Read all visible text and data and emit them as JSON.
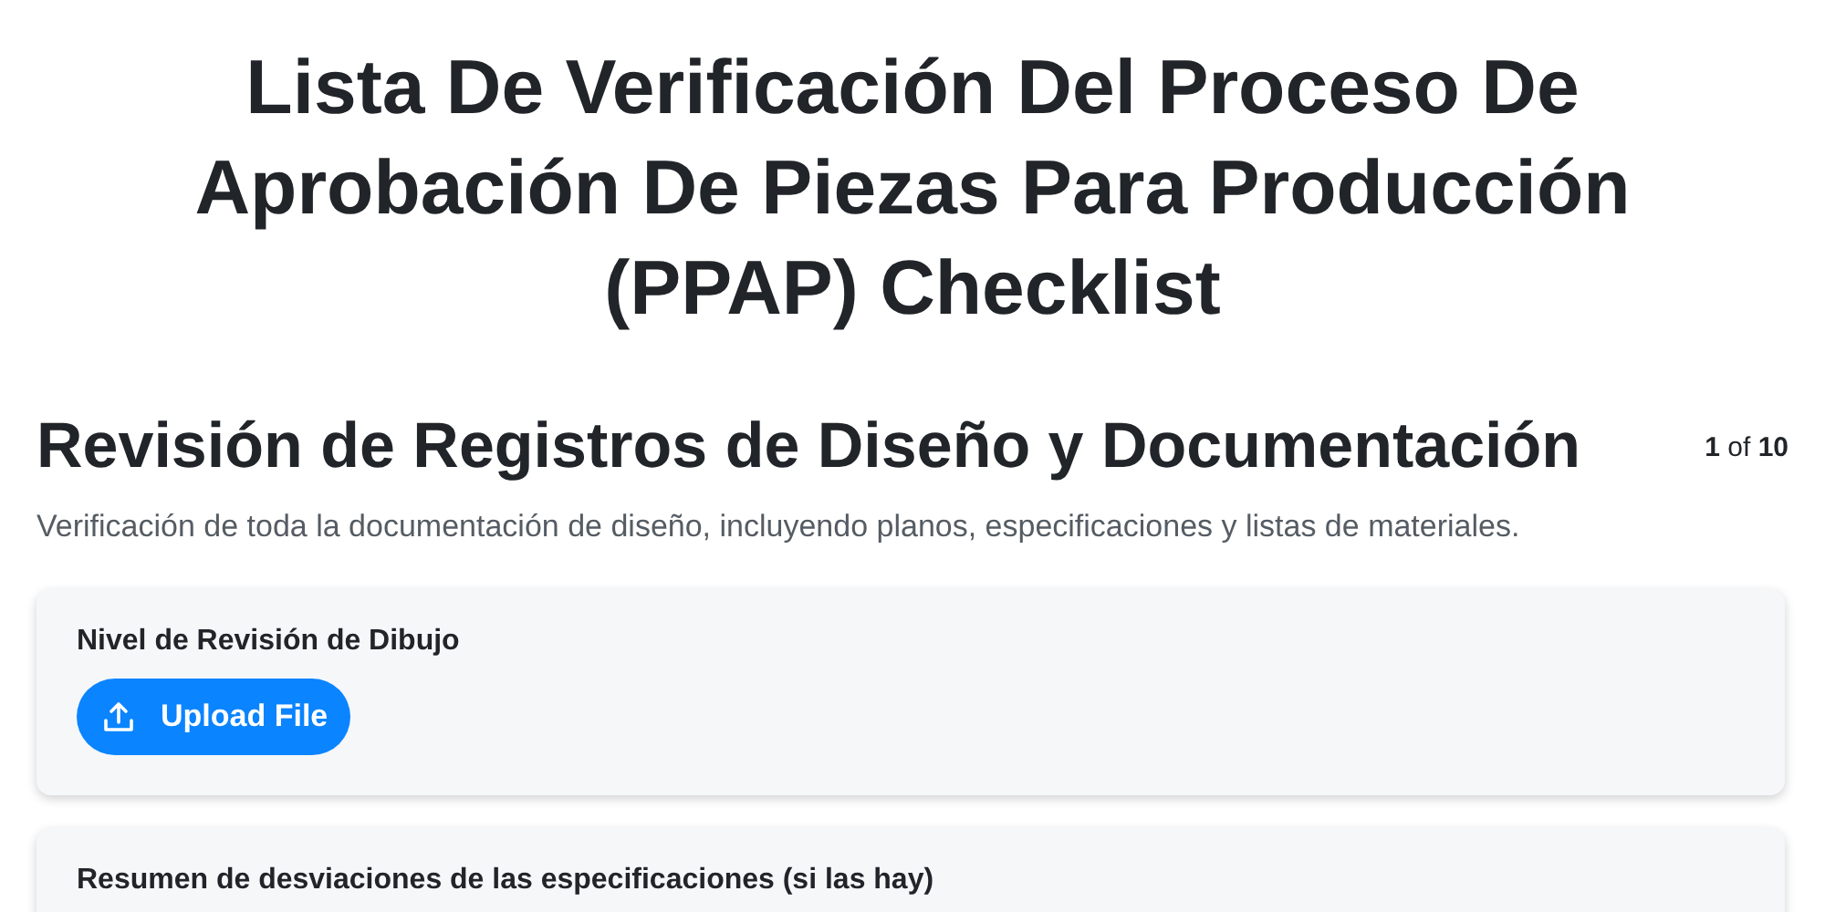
{
  "title": "Lista De Verificación Del Proceso De Aprobación De Piezas Para Producción (PPAP) Checklist",
  "section": {
    "heading": "Revisión de Registros de Diseño y Documentación",
    "pagination": "**1** of **10**",
    "description": "Verificación de toda la documentación de diseño, incluyendo planos, especificaciones y listas de materiales."
  },
  "items": [
    {
      "kind": "upload",
      "label": "Nivel de Revisión de Dibujo",
      "button": "Upload File"
    },
    {
      "kind": "text",
      "label": "Resumen de desviaciones de las especificaciones (si las hay)"
    }
  ]
}
